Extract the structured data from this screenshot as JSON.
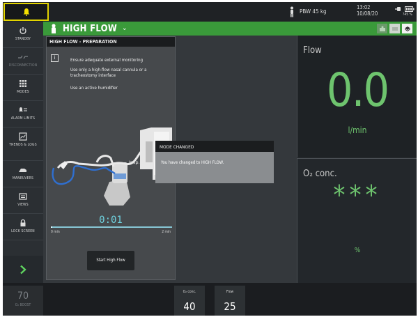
{
  "topbar": {
    "alarm_icon": "bell-icon",
    "patient_icon": "person-icon",
    "pbw": "PBW 45 kg",
    "time": "13:02",
    "date": "10/08/20",
    "battery_pct": "?45 %"
  },
  "sidebar": {
    "items": [
      {
        "label": "STANDBY",
        "icon": "power-icon",
        "enabled": true
      },
      {
        "label": "DISCONNECTION",
        "icon": "disconnection-icon",
        "enabled": false
      },
      {
        "label": "MODES",
        "icon": "grid-icon",
        "enabled": true
      },
      {
        "label": "ALARM LIMITS",
        "icon": "alarm-limits-icon",
        "enabled": true
      },
      {
        "label": "TRENDS & LOGS",
        "icon": "trends-icon",
        "enabled": true
      },
      {
        "label": "MANEUVERS",
        "icon": "maneuvers-icon",
        "enabled": true
      },
      {
        "label": "VIEWS",
        "icon": "views-icon",
        "enabled": true
      },
      {
        "label": "LOCK SCREEN",
        "icon": "lock-icon",
        "enabled": true
      }
    ],
    "next_icon": "chevron-right-icon"
  },
  "header": {
    "mode_title": "HIGH FLOW",
    "accent_color": "#3a9a3a"
  },
  "prep": {
    "title": "HIGH FLOW - PREPARATION",
    "instructions": [
      "Ensure adequate external monitoring",
      "Use only a high-flow nasal cannula or a tracheostomy interface",
      "Use an active humidifier"
    ],
    "diagram_label": "Insp.",
    "timer": "0:01",
    "progress_fraction": 0.01,
    "tick_start": "0 min",
    "tick_end": "2 min",
    "start_button": "Start High Flow"
  },
  "popup": {
    "title": "MODE CHANGED",
    "message": "You have changed to HIGH FLOW."
  },
  "measurements": {
    "flow": {
      "label": "Flow",
      "value": "0.0",
      "unit": "l/min"
    },
    "o2": {
      "label": "O₂ conc.",
      "value": "***",
      "unit": "%"
    }
  },
  "bottombar": {
    "boost_value": "70",
    "boost_label": "O₂ BOOST",
    "settings": [
      {
        "label": "O₂ conc.",
        "value": "40"
      },
      {
        "label": "Flow",
        "value": "25"
      }
    ]
  }
}
